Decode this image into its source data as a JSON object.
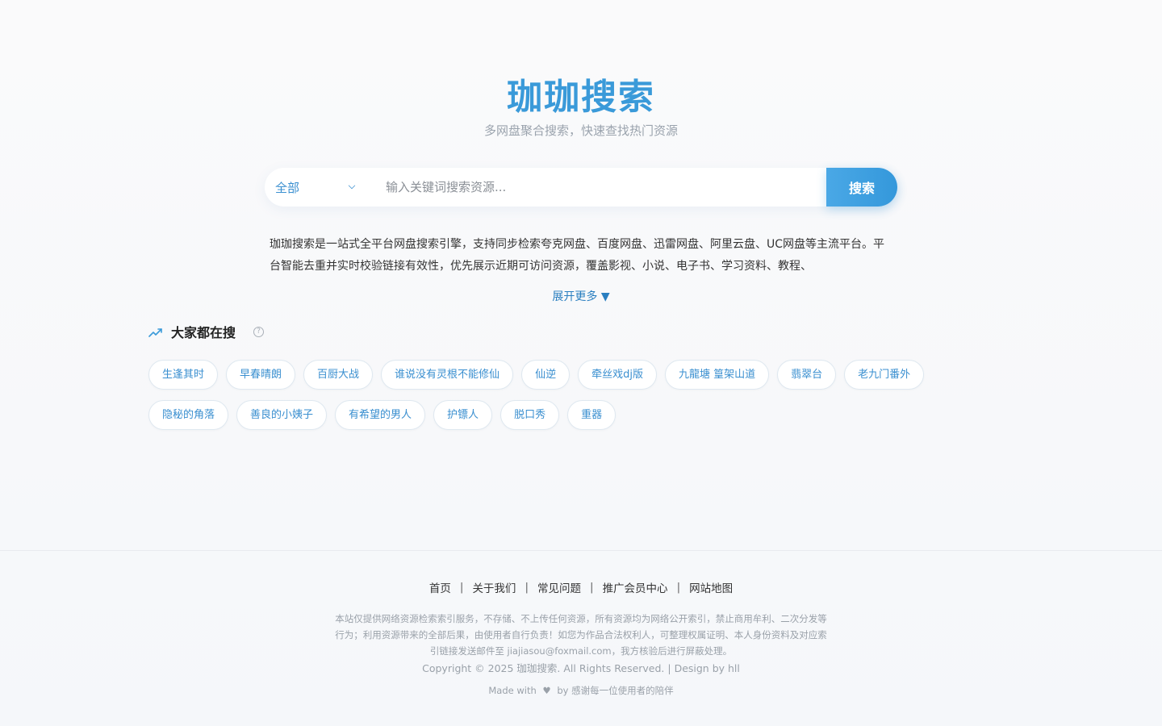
{
  "header": {
    "title": "珈珈搜索",
    "subtitle": "多网盘聚合搜索，快速查找热门资源"
  },
  "search": {
    "category_selected": "全部",
    "placeholder": "输入关键词搜索资源...",
    "button_label": "搜索"
  },
  "intro": {
    "text": "珈珈搜索是一站式全平台网盘搜索引擎，支持同步检索夸克网盘、百度网盘、迅雷网盘、阿里云盘、UC网盘等主流平台。平台智能去重并实时校验链接有效性，优先展示近期可访问资源，覆盖影视、小说、电子书、学习资料、教程、",
    "expand_label": "展开更多 ▼"
  },
  "trending": {
    "title": "大家都在搜",
    "help_icon": "?",
    "tags": [
      "生逢其时",
      "早春晴朗",
      "百厨大战",
      "谁说没有灵根不能修仙",
      "仙逆",
      "牵丝戏dj版",
      "九龍塘 篁架山道",
      "翡翠台",
      "老九门番外",
      "隐秘的角落",
      "善良的小姨子",
      "有希望的男人",
      "护镖人",
      "脱口秀",
      "重器"
    ]
  },
  "footer": {
    "nav": [
      "首页",
      "关于我们",
      "常见问题",
      "推广会员中心",
      "网站地图"
    ],
    "separator": "|",
    "disclaimer": "本站仅提供网络资源检索索引服务，不存储、不上传任何资源，所有资源均为网络公开索引，禁止商用牟利、二次分发等行为；利用资源带来的全部后果，由使用者自行负责！如您为作品合法权利人，可整理权属证明、本人身份资料及对应索引链接发送邮件至 jiajiasou@foxmail.com，我方核验后进行屏蔽处理。",
    "copyright": "Copyright © 2025 珈珈搜索. All Rights Reserved. | Design by hll",
    "made_with_prefix": "Made with",
    "heart": "♥",
    "made_with_suffix": "by 感谢每一位使用者的陪伴"
  },
  "colors": {
    "accent": "#3a9ad9",
    "link": "#3a8fd0",
    "muted": "#9aa1a9"
  }
}
